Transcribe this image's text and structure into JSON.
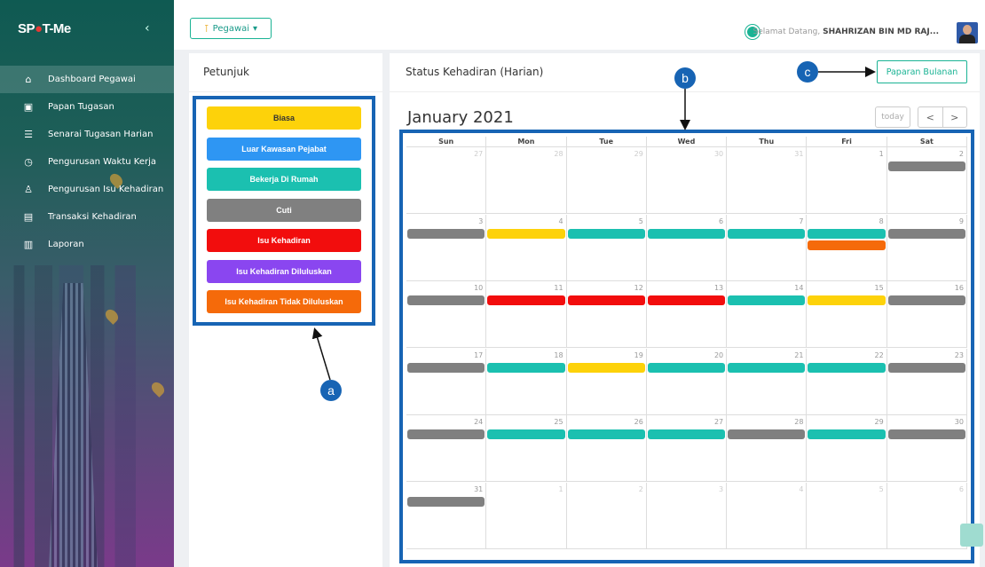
{
  "sidebar": {
    "logo_left": "SP",
    "logo_dot": "●",
    "logo_right": "T-Me",
    "items": [
      {
        "label": "Dashboard Pegawai",
        "icon": "home-icon",
        "glyph": "⌂"
      },
      {
        "label": "Papan Tugasan",
        "icon": "board-icon",
        "glyph": "▣"
      },
      {
        "label": "Senarai Tugasan Harian",
        "icon": "list-icon",
        "glyph": "☰"
      },
      {
        "label": "Pengurusan Waktu Kerja",
        "icon": "clock-icon",
        "glyph": "◷"
      },
      {
        "label": "Pengurusan Isu Kehadiran",
        "icon": "user-icon",
        "glyph": "♙"
      },
      {
        "label": "Transaksi Kehadiran",
        "icon": "document-icon",
        "glyph": "▤"
      },
      {
        "label": "Laporan",
        "icon": "report-icon",
        "glyph": "▥"
      }
    ]
  },
  "topbar": {
    "role_label": "Pegawai",
    "greeting": "Selamat Datang,",
    "user_name": "SHAHRIZAN BIN MD RAJ..."
  },
  "legend": {
    "title": "Petunjuk",
    "items": [
      {
        "label": "Biasa",
        "color": "#fdd20a"
      },
      {
        "label": "Luar Kawasan Pejabat",
        "color": "#2e96f3"
      },
      {
        "label": "Bekerja Di Rumah",
        "color": "#1bc0b0"
      },
      {
        "label": "Cuti",
        "color": "#808080"
      },
      {
        "label": "Isu Kehadiran",
        "color": "#f20d0d"
      },
      {
        "label": "Isu Kehadiran Diluluskan",
        "color": "#8a46f0"
      },
      {
        "label": "Isu Kehadiran Tidak Diluluskan",
        "color": "#f56a0a"
      }
    ]
  },
  "calendar": {
    "panel_title": "Status Kehadiran (Harian)",
    "monthly_button": "Paparan Bulanan",
    "month_title": "January 2021",
    "today_label": "today",
    "prev_label": "<",
    "next_label": ">",
    "weekdays": [
      "Sun",
      "Mon",
      "Tue",
      "Wed",
      "Thu",
      "Fri",
      "Sat"
    ],
    "weeks": [
      [
        {
          "d": "27",
          "o": true,
          "e": []
        },
        {
          "d": "28",
          "o": true,
          "e": []
        },
        {
          "d": "29",
          "o": true,
          "e": []
        },
        {
          "d": "30",
          "o": true,
          "e": []
        },
        {
          "d": "31",
          "o": true,
          "e": []
        },
        {
          "d": "1",
          "o": false,
          "e": []
        },
        {
          "d": "2",
          "o": false,
          "e": [
            "#808080"
          ]
        }
      ],
      [
        {
          "d": "3",
          "o": false,
          "e": [
            "#808080"
          ]
        },
        {
          "d": "4",
          "o": false,
          "e": [
            "#fdd20a"
          ]
        },
        {
          "d": "5",
          "o": false,
          "e": [
            "#1bc0b0"
          ]
        },
        {
          "d": "6",
          "o": false,
          "e": [
            "#1bc0b0"
          ]
        },
        {
          "d": "7",
          "o": false,
          "e": [
            "#1bc0b0"
          ]
        },
        {
          "d": "8",
          "o": false,
          "e": [
            "#1bc0b0",
            "#f56a0a"
          ]
        },
        {
          "d": "9",
          "o": false,
          "e": [
            "#808080"
          ]
        }
      ],
      [
        {
          "d": "10",
          "o": false,
          "e": [
            "#808080"
          ]
        },
        {
          "d": "11",
          "o": false,
          "e": [
            "#f20d0d"
          ]
        },
        {
          "d": "12",
          "o": false,
          "e": [
            "#f20d0d"
          ]
        },
        {
          "d": "13",
          "o": false,
          "e": [
            "#f20d0d"
          ]
        },
        {
          "d": "14",
          "o": false,
          "e": [
            "#1bc0b0"
          ]
        },
        {
          "d": "15",
          "o": false,
          "e": [
            "#fdd20a"
          ]
        },
        {
          "d": "16",
          "o": false,
          "e": [
            "#808080"
          ]
        }
      ],
      [
        {
          "d": "17",
          "o": false,
          "e": [
            "#808080"
          ]
        },
        {
          "d": "18",
          "o": false,
          "e": [
            "#1bc0b0"
          ]
        },
        {
          "d": "19",
          "o": false,
          "e": [
            "#fdd20a"
          ]
        },
        {
          "d": "20",
          "o": false,
          "e": [
            "#1bc0b0"
          ]
        },
        {
          "d": "21",
          "o": false,
          "e": [
            "#1bc0b0"
          ]
        },
        {
          "d": "22",
          "o": false,
          "e": [
            "#1bc0b0"
          ]
        },
        {
          "d": "23",
          "o": false,
          "e": [
            "#808080"
          ]
        }
      ],
      [
        {
          "d": "24",
          "o": false,
          "e": [
            "#808080"
          ]
        },
        {
          "d": "25",
          "o": false,
          "e": [
            "#1bc0b0"
          ]
        },
        {
          "d": "26",
          "o": false,
          "e": [
            "#1bc0b0"
          ]
        },
        {
          "d": "27",
          "o": false,
          "e": [
            "#1bc0b0"
          ]
        },
        {
          "d": "28",
          "o": false,
          "e": [
            "#808080"
          ]
        },
        {
          "d": "29",
          "o": false,
          "e": [
            "#1bc0b0"
          ]
        },
        {
          "d": "30",
          "o": false,
          "e": [
            "#808080"
          ]
        }
      ],
      [
        {
          "d": "31",
          "o": false,
          "e": [
            "#808080"
          ]
        },
        {
          "d": "1",
          "o": true,
          "e": []
        },
        {
          "d": "2",
          "o": true,
          "e": []
        },
        {
          "d": "3",
          "o": true,
          "e": []
        },
        {
          "d": "4",
          "o": true,
          "e": []
        },
        {
          "d": "5",
          "o": true,
          "e": []
        },
        {
          "d": "6",
          "o": true,
          "e": []
        }
      ]
    ]
  },
  "annotations": {
    "a": "a",
    "b": "b",
    "c": "c"
  },
  "colors": {
    "accent": "#1ab394",
    "highlight_border": "#1764b4"
  }
}
